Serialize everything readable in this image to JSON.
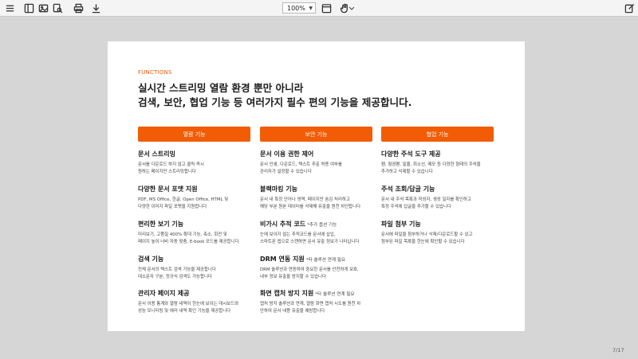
{
  "toolbar": {
    "zoom_value": "100%",
    "icons": [
      "menu-icon",
      "sidebar-icon",
      "image-gallery-icon",
      "search-page-icon",
      "print-icon",
      "download-icon",
      "calendar-view-icon",
      "hand-tool-icon",
      "chevron-down-icon",
      "edit-icon"
    ]
  },
  "page": {
    "eyebrow": "FUNCTIONS",
    "headline_line1": "실시간 스트리밍 열람 환경 뿐만 아니라",
    "headline_line2": "검색, 보안, 협업 기능 등 여러가지 필수 편의 기능을 제공합니다.",
    "accent_color": "#f25c05",
    "columns": [
      {
        "label": "열람 기능",
        "items": [
          {
            "title": "문서 스트리밍",
            "note": "",
            "desc1": "문서를 다운로드 하지 않고 클릭 즉시",
            "desc2": "원하는 페이지만 스트리밍합니다"
          },
          {
            "title": "다양한 문서 포맷 지원",
            "note": "",
            "desc1": "PDF, MS Office, 한글, Open Office, HTML 및",
            "desc2": "다양한 이미지 파일 포맷을 지원합니다"
          },
          {
            "title": "편리한 보기 기능",
            "note": "",
            "desc1": "미리보기, 고품질 400% 확대 기능, 축소, 회전 및",
            "desc2": "페이지 높이·너비 자동 맞춤, E-book 모드를 제공합니다"
          },
          {
            "title": "검색 기능",
            "note": "",
            "desc1": "전체 문서의 텍스트 검색 기능을 제공합니다",
            "desc2": "대소문자 구분, 정규식 검색도 가능합니다"
          },
          {
            "title": "관리자 페이지 제공",
            "note": "",
            "desc1": "문서 이용 통계와 열람 내역이 한눈에 보이는 대시보드와",
            "desc2": "성능 모니터링 및 에러 내역 확인 기능을 제공합니다"
          }
        ]
      },
      {
        "label": "보안 기능",
        "items": [
          {
            "title": "문서 이용 권한 제어",
            "note": "",
            "desc1": "문서 인쇄, 다운로드, 텍스트 추출 허용 여부를",
            "desc2": "관리자가 설정할 수 있습니다"
          },
          {
            "title": "블랙마킹 기능",
            "note": "",
            "desc1": "문서 내 특정 단어나 영역, 페이지만 숨김 처리하고",
            "desc2": "해당 부분 원본 데이터를 삭제해 유출을 원천 차단합니다"
          },
          {
            "title": "비가시 추적 코드",
            "note": "*추가 옵션 기능",
            "desc1": "눈에 보이지 않는 추적코드를 문서에 삽입,",
            "desc2": "스마트폰 앱으로 스캔하면 문서 유출 정보가 나타납니다"
          },
          {
            "title": "DRM 연동 지원",
            "note": "*타 솔루션 연계 필요",
            "desc1": "DRM 솔루션과 연동하여 중요한 문서를 안전하게 보호,",
            "desc2": "내부 정보 유출을 방지할 수 있습니다"
          },
          {
            "title": "화면 캡처 방지 지원",
            "note": "*타 솔루션 연계 필요",
            "desc1": "캡처 방지 솔루션과 연계, 열람 화면 캡처 시도를 원천 차",
            "desc2": "단하여 문서 내용 유출을 예방합니다"
          }
        ]
      },
      {
        "label": "협업 기능",
        "items": [
          {
            "title": "다양한 주석 도구 제공",
            "note": "",
            "desc1": "펜, 형광펜, 밑줄, 취소선, 메모 등 다양한 형태의 주석을",
            "desc2": "추가하고 삭제할 수 있습니다"
          },
          {
            "title": "주석 조회/답글 기능",
            "note": "",
            "desc1": "문서 내 주석 목록과 작성자, 생성 일자를 확인하고",
            "desc2": "특정 주석에 답글을 추가할 수 있습니다"
          },
          {
            "title": "파일 첨부 기능",
            "note": "",
            "desc1": "문서에 파일을 첨부하거나 삭제/다운로드할 수 있고",
            "desc2": "첨부된 파일 목록을 한눈에 확인할 수 있습니다"
          }
        ]
      }
    ]
  },
  "footer": {
    "page_indicator": "7/17"
  }
}
